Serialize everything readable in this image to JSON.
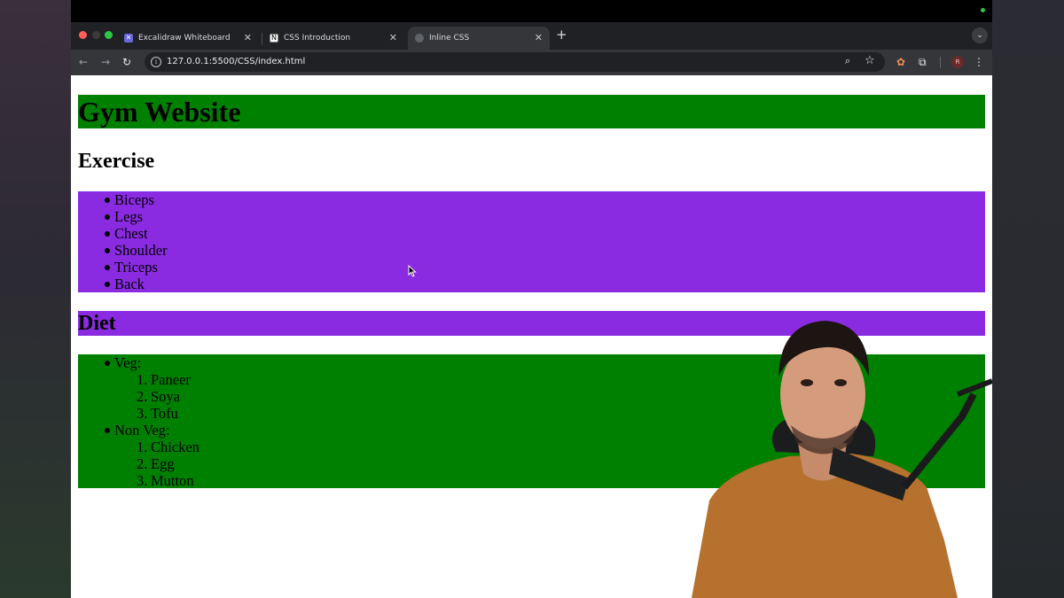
{
  "browser": {
    "tabs": [
      {
        "title": "Excalidraw Whiteboard",
        "icon": "excalidraw-icon",
        "active": false
      },
      {
        "title": "CSS Introduction",
        "icon": "notion-icon",
        "active": false
      },
      {
        "title": "Inline CSS",
        "icon": "globe-icon",
        "active": true
      }
    ],
    "url": "127.0.0.1:5500/CSS/index.html",
    "profile_initial": "R"
  },
  "page": {
    "title": "Gym Website",
    "exercise_heading": "Exercise",
    "exercises": [
      "Biceps",
      "Legs",
      "Chest",
      "Shoulder",
      "Triceps",
      "Back"
    ],
    "diet_heading": "Diet",
    "diet": [
      {
        "label": "Veg:",
        "items": [
          "Paneer",
          "Soya",
          "Tofu"
        ]
      },
      {
        "label": "Non Veg:",
        "items": [
          "Chicken",
          "Egg",
          "Mutton"
        ]
      }
    ]
  },
  "colors": {
    "green_block": "#008000",
    "purple_block": "#8a2be2",
    "page_background": "#ffffff",
    "browser_chrome": "#202124",
    "toolbar": "#35363a"
  }
}
